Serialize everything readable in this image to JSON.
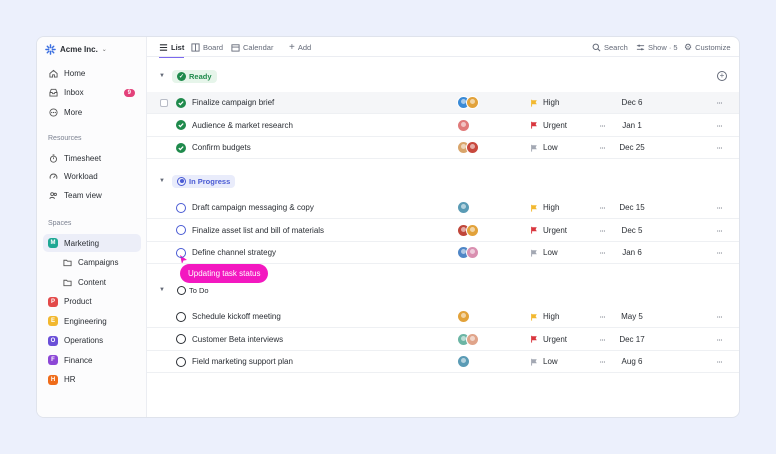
{
  "workspace": {
    "name": "Acme Inc."
  },
  "sidebar": {
    "top_items": [
      {
        "label": "Home",
        "icon": "home-icon"
      },
      {
        "label": "Inbox",
        "icon": "inbox-icon",
        "count": "9"
      },
      {
        "label": "More",
        "icon": "more-icon"
      }
    ],
    "resources_label": "Resources",
    "resources": [
      {
        "label": "Timesheet",
        "icon": "stopwatch-icon"
      },
      {
        "label": "Workload",
        "icon": "gauge-icon"
      },
      {
        "label": "Team view",
        "icon": "team-icon"
      }
    ],
    "spaces_label": "Spaces",
    "spaces": [
      {
        "label": "Marketing",
        "letter": "M",
        "color": "#1fa894",
        "active": true
      },
      {
        "label": "Campaigns",
        "folder": true
      },
      {
        "label": "Content",
        "folder": true
      },
      {
        "label": "Product",
        "letter": "P",
        "color": "#e34a4a"
      },
      {
        "label": "Engineering",
        "letter": "E",
        "color": "#f2b82f"
      },
      {
        "label": "Operations",
        "letter": "O",
        "color": "#6a4fd8"
      },
      {
        "label": "Finance",
        "letter": "F",
        "color": "#8c47d6"
      },
      {
        "label": "HR",
        "letter": "H",
        "color": "#ef6c1a"
      }
    ]
  },
  "toolbar": {
    "tabs": [
      {
        "label": "List",
        "active": true
      },
      {
        "label": "Board"
      },
      {
        "label": "Calendar"
      },
      {
        "label": "Add"
      }
    ],
    "search_label": "Search",
    "show_label": "Show · 5",
    "customize_label": "Customize"
  },
  "groups": [
    {
      "label": "Ready",
      "color": "#1f8a4c",
      "bg": "#e6f5ea",
      "tasks": [
        {
          "name": "Finalize campaign brief",
          "priority": "High",
          "due": "Dec 6",
          "done": true,
          "avatars": [
            "#3a8ad6",
            "#e2a23a"
          ],
          "highlight": true
        },
        {
          "name": "Audience & market research",
          "priority": "Urgent",
          "due": "Jan 1",
          "done": true,
          "avatars": [
            "#e07a7a"
          ]
        },
        {
          "name": "Confirm budgets",
          "priority": "Low",
          "due": "Dec 25",
          "done": true,
          "avatars": [
            "#d9a56b",
            "#c8483d"
          ]
        }
      ]
    },
    {
      "label": "In Progress",
      "color": "#4a5bd4",
      "bg": "#e9ecfb",
      "tasks": [
        {
          "name": "Draft campaign messaging & copy",
          "priority": "High",
          "due": "Dec 15",
          "avatars": [
            "#5a9bb5"
          ]
        },
        {
          "name": "Finalize asset list and bill of materials",
          "priority": "Urgent",
          "due": "Dec 5",
          "avatars": [
            "#c0463a",
            "#e2a23a"
          ]
        },
        {
          "name": "Define channel strategy",
          "priority": "Low",
          "due": "Jan 6",
          "avatars": [
            "#4f86c6",
            "#d98fb0"
          ]
        }
      ]
    },
    {
      "label": "To Do",
      "color": "#2a2e34",
      "bg": "transparent",
      "tasks": [
        {
          "name": "Schedule kickoff meeting",
          "priority": "High",
          "due": "May 5",
          "avatars": [
            "#e2a23a"
          ]
        },
        {
          "name": "Customer Beta interviews",
          "priority": "Urgent",
          "due": "Dec 17",
          "avatars": [
            "#6bb5a4",
            "#e0a48a"
          ]
        },
        {
          "name": "Field marketing support plan",
          "priority": "Low",
          "due": "Aug 6",
          "avatars": [
            "#5a9bb5"
          ]
        }
      ]
    }
  ],
  "priority_colors": {
    "High": "#f2b82f",
    "Urgent": "#d9363e",
    "Low": "#a3a8b3"
  },
  "tooltip": {
    "text": "Updating task status",
    "color": "#f318c0"
  }
}
